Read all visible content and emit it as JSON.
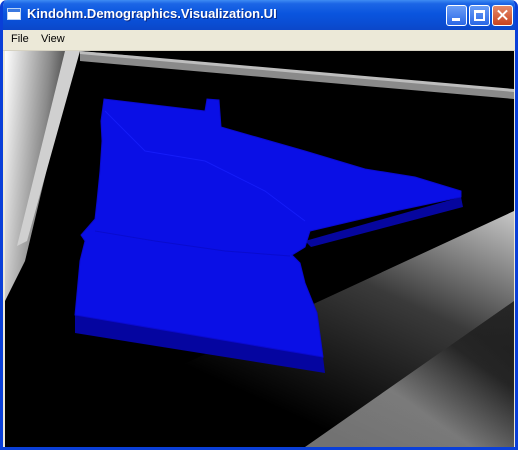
{
  "window": {
    "title": "Kindohm.Demographics.Visualization.UI",
    "controls": [
      "minimize",
      "maximize",
      "close"
    ]
  },
  "menu": {
    "items": [
      {
        "label": "File"
      },
      {
        "label": "View"
      }
    ]
  },
  "viewport": {
    "background": "#000000",
    "region_color": "#0a0fe6",
    "region_side_color": "#0a0aa8",
    "scene_icons": [
      "minnesota-state-mesh",
      "floor-plane",
      "wall-plane"
    ]
  }
}
